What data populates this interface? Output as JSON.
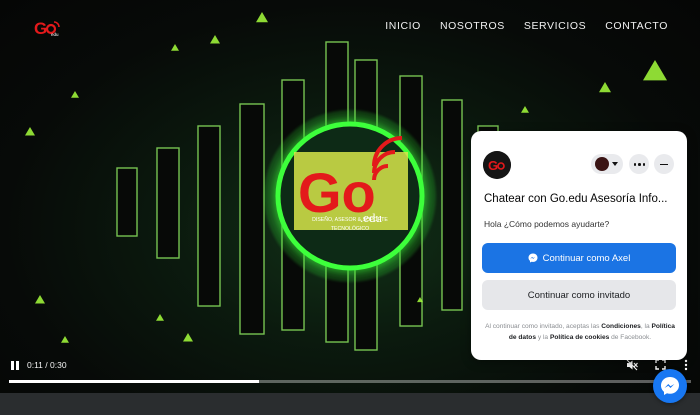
{
  "header": {
    "logo_text": "Go.edu",
    "nav": [
      "INICIO",
      "NOSOTROS",
      "SERVICIOS",
      "CONTACTO"
    ]
  },
  "video": {
    "center_logo": {
      "brand": "Go",
      "suffix": ".edu",
      "tagline_1": "DISEÑO, ASESOR & SOPORTE",
      "tagline_2": "TECNOLÓGICO"
    },
    "time": "0:11 / 0:30",
    "progress_fraction": 0.367
  },
  "chat": {
    "title": "Chatear con Go.edu Asesoría Info...",
    "greeting": "Hola ¿Cómo podemos ayudarte?",
    "primary_button": "Continuar como Axel",
    "secondary_button": "Continuar como invitado",
    "legal": {
      "p1": "Al continuar como invitado, aceptas las ",
      "link1": "Condiciones",
      "p2": ", la ",
      "link2": "Política de datos",
      "p3": " y la ",
      "link3": "Política de cookies",
      "p4": " de Facebook."
    }
  },
  "colors": {
    "accent_green": "#39ff3c",
    "brand_red": "#e3191b",
    "messenger_blue": "#1877f2",
    "button_blue": "#1b74e4"
  },
  "icons": [
    "play-pause-icon",
    "mute-icon",
    "fullscreen-icon",
    "more-vert-icon",
    "messenger-icon",
    "minus-icon",
    "ellipsis-icon",
    "caret-down-icon"
  ]
}
